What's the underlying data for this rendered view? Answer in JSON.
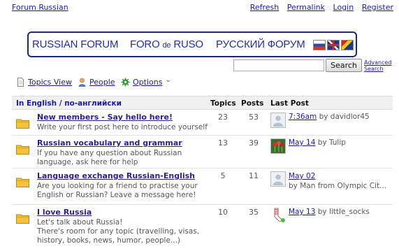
{
  "top": {
    "forum_title": "Forum Russian",
    "links": [
      "Refresh",
      "Permalink",
      "Login",
      "Register"
    ]
  },
  "banner": {
    "title_en": "RUSSIAN FORUM",
    "title_es_1": "FORO",
    "title_es_de": "de",
    "title_es_2": "RUSO",
    "title_ru": "РУССКИЙ ФОРУМ"
  },
  "search": {
    "placeholder": "",
    "button": "Search",
    "advanced_1": "Advanced",
    "advanced_2": "Search"
  },
  "viewbar": {
    "topics_view": "Topics View",
    "people": "People",
    "options": "Options",
    "options_chevron": "⌄"
  },
  "table": {
    "category": "In English / по-английски",
    "col_topics": "Topics",
    "col_posts": "Posts",
    "col_last": "Last Post",
    "rows": [
      {
        "title": "New members - Say hello here!",
        "desc": "Write your first post here to introduce yourself",
        "topics": "23",
        "posts": "53",
        "last_link": "7:36am",
        "last_by": " by davidlor45",
        "avatar": "avatar-default"
      },
      {
        "title": "Russian vocabulary and grammar",
        "desc": "If you have any question about Russian language, ask here for help",
        "topics": "13",
        "posts": "39",
        "last_link": "May 14",
        "last_by": " by Tulip",
        "avatar": "avatar-tulip"
      },
      {
        "title": "Language exchange Russian-English",
        "desc": "Are you looking for a friend to practise your English or Russian? Leave a message here!",
        "topics": "5",
        "posts": "11",
        "last_link": "May 02",
        "last_by": "by Man from Olympic Cit...",
        "avatar": "avatar-default"
      },
      {
        "title": "I love Russia",
        "desc": "Let's talk about Russia!",
        "desc2": "There's room for any topic (travelling, visas, history, books, news, humor, people...)",
        "topics": "10",
        "posts": "35",
        "last_link": "May 13",
        "last_by": " by little_socks",
        "avatar": "avatar-socks"
      }
    ]
  },
  "colors": {
    "link": "#1a1aa6",
    "banner_text": "#1e2ea8",
    "folder": "#f2c23c"
  }
}
